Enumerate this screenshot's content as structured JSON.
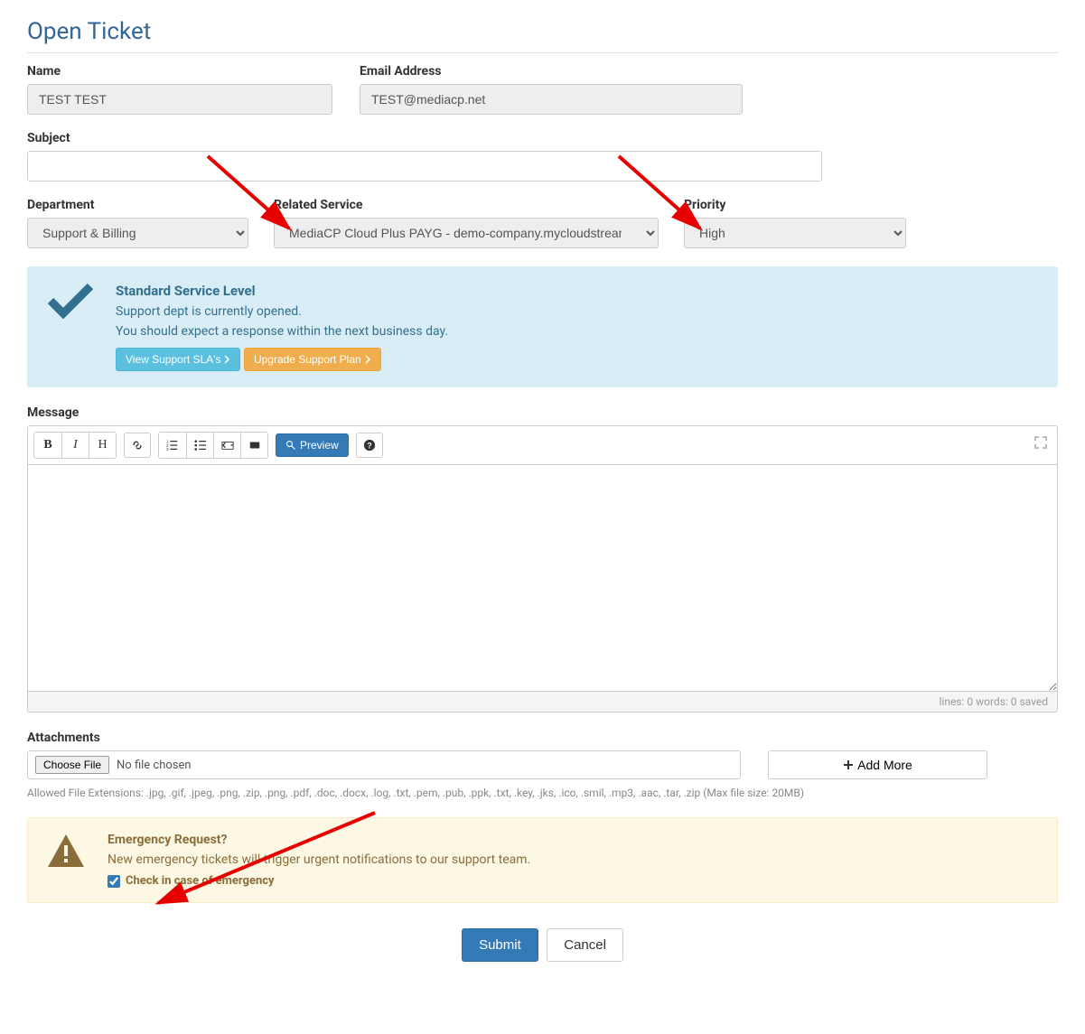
{
  "page_title": "Open Ticket",
  "name": {
    "label": "Name",
    "value": "TEST TEST"
  },
  "email": {
    "label": "Email Address",
    "value": "TEST@mediacp.net"
  },
  "subject": {
    "label": "Subject",
    "value": ""
  },
  "department": {
    "label": "Department",
    "selected": "Support & Billing"
  },
  "related_service": {
    "label": "Related Service",
    "selected": "MediaCP Cloud Plus PAYG - demo-company.mycloudstream.io ("
  },
  "priority": {
    "label": "Priority",
    "selected": "High"
  },
  "sla": {
    "title": "Standard Service Level",
    "line1": "Support dept is currently opened.",
    "line2": "You should expect a response within the next business day.",
    "view_btn": "View Support SLA's",
    "upgrade_btn": "Upgrade Support Plan"
  },
  "message": {
    "label": "Message",
    "preview_btn": "Preview",
    "status": "lines: 0   words: 0   saved"
  },
  "attachments": {
    "label": "Attachments",
    "choose_btn": "Choose File",
    "no_file": "No file chosen",
    "add_more": "Add More",
    "hint": "Allowed File Extensions: .jpg, .gif, .jpeg, .png, .zip, .png, .pdf, .doc, .docx, .log, .txt, .pem, .pub, .ppk, .txt, .key, .jks, .ico, .smil, .mp3, .aac, .tar, .zip (Max file size: 20MB)"
  },
  "emergency": {
    "title": "Emergency Request?",
    "desc": "New emergency tickets will trigger urgent notifications to our support team.",
    "check_label": "Check in case of emergency"
  },
  "submit": "Submit",
  "cancel": "Cancel"
}
